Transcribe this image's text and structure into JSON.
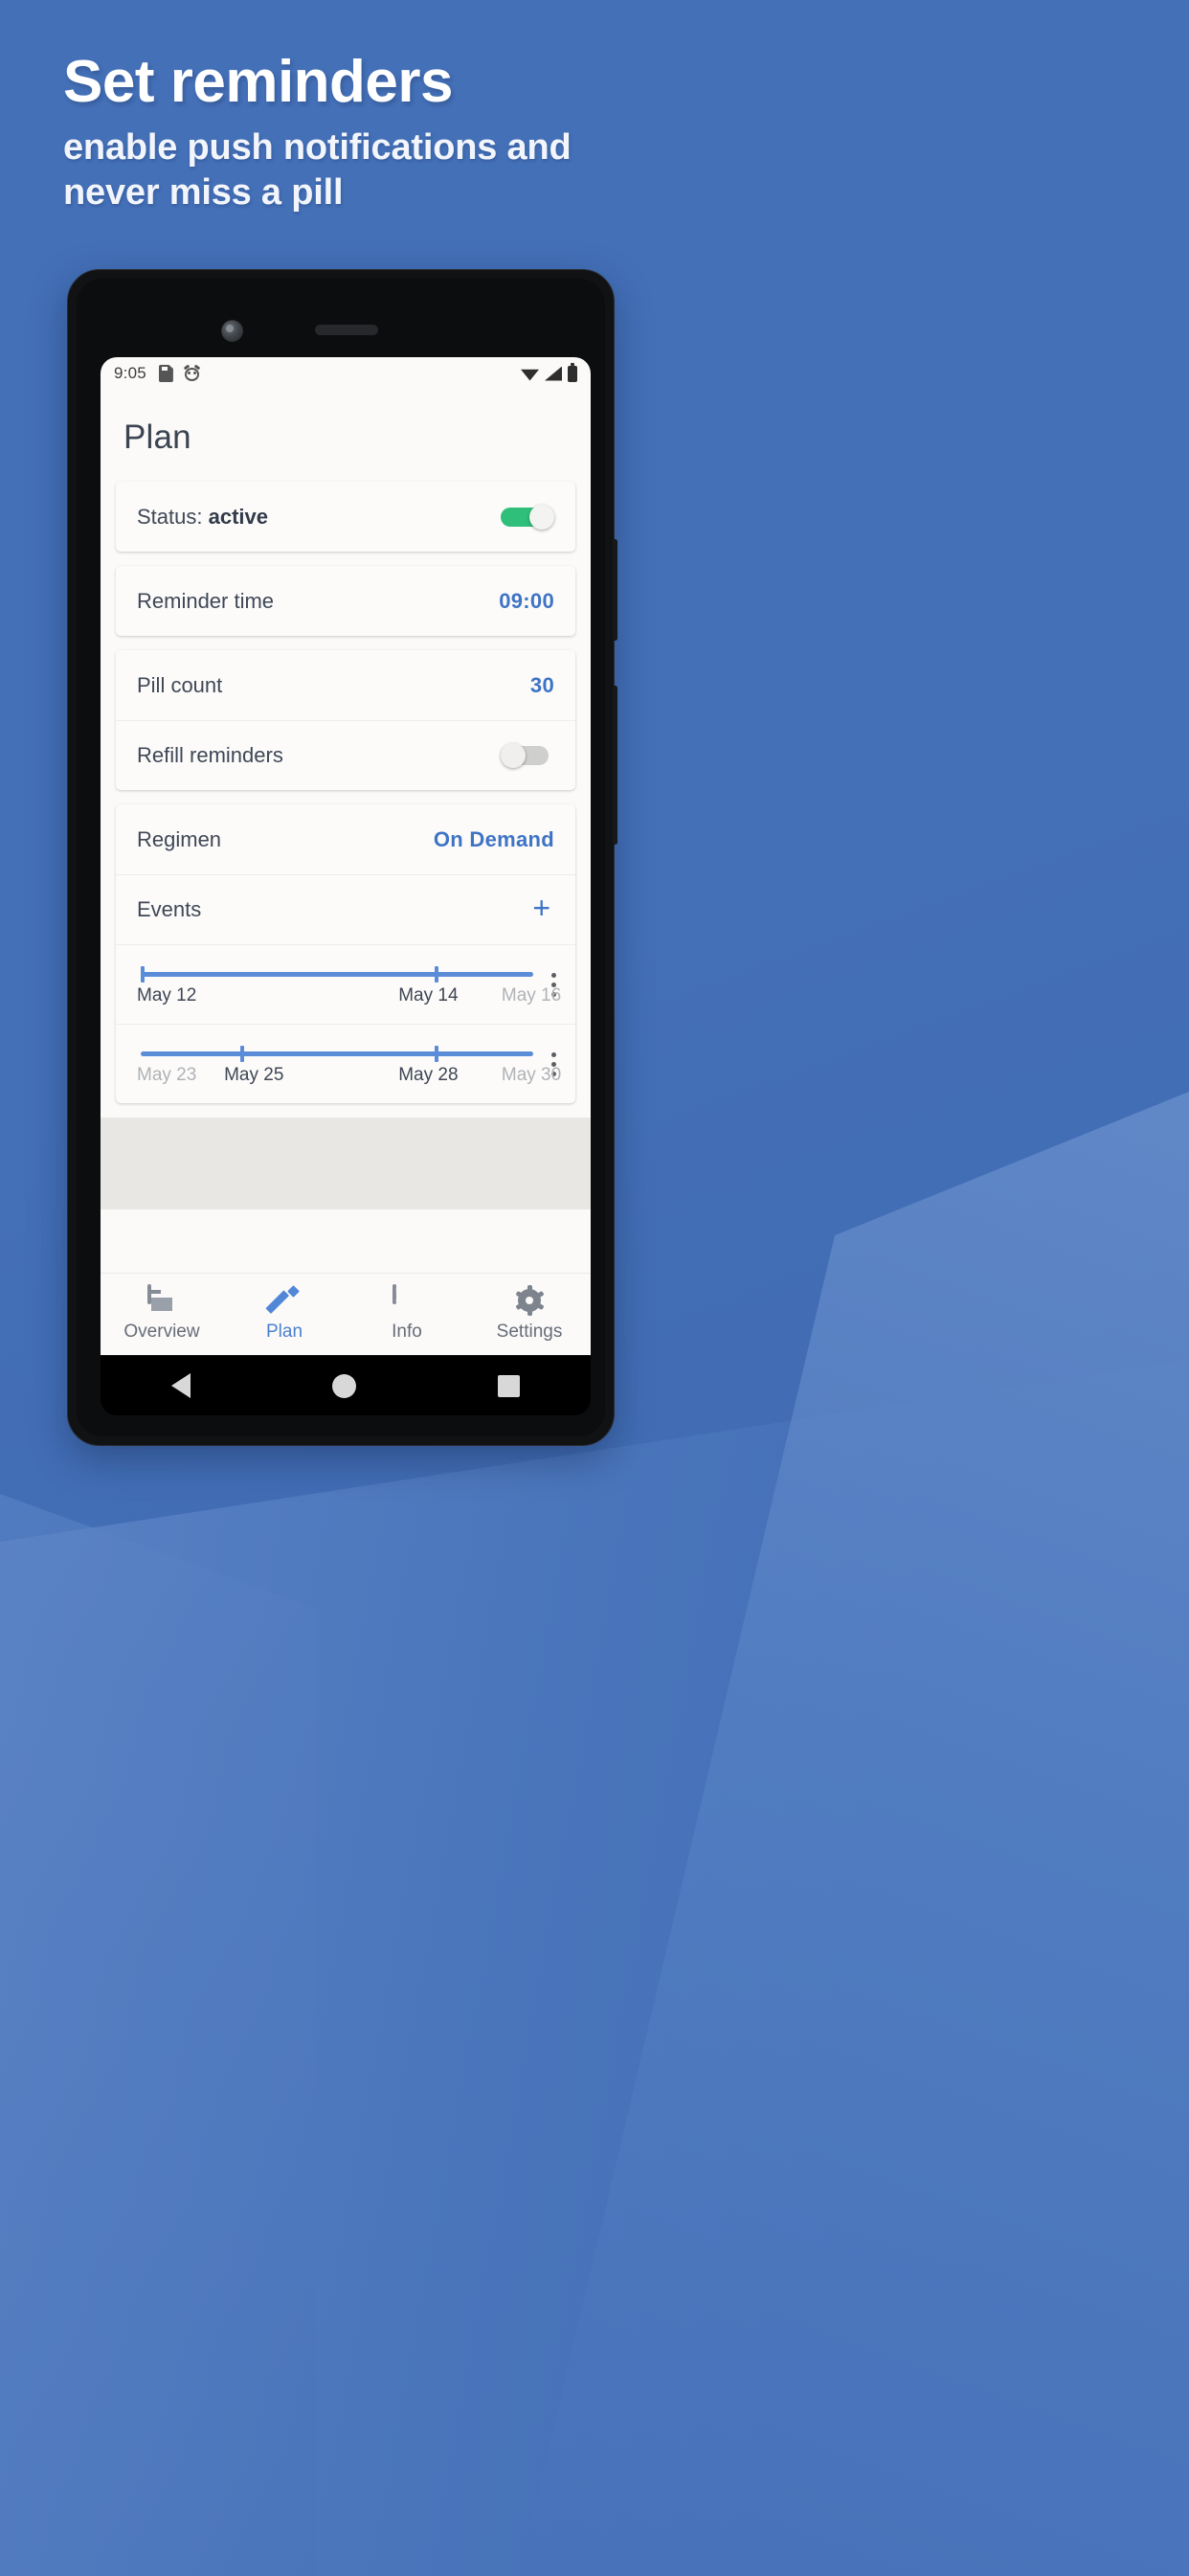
{
  "promo": {
    "headline": "Set reminders",
    "subhead": "enable push notifications and never miss a pill"
  },
  "colors": {
    "background_blue": "#4470b8",
    "accent_blue": "#3f74c4",
    "timeline_blue": "#5b8cd8",
    "toggle_on_green": "#2fbf7a",
    "toggle_off_gray": "#cfcfcd",
    "nav_active": "#4a80d0",
    "nav_inactive": "#666c77"
  },
  "statusbar": {
    "time": "9:05",
    "left_icons": [
      "sd-card-icon",
      "alarm-icon"
    ],
    "right_icons": [
      "wifi-icon",
      "signal-icon",
      "battery-icon"
    ]
  },
  "screen": {
    "page_title": "Plan",
    "cards": [
      {
        "rows": [
          {
            "label_prefix": "Status: ",
            "label_strong": "active",
            "control": "toggle",
            "toggle_state": "on"
          }
        ]
      },
      {
        "rows": [
          {
            "label": "Reminder time",
            "value": "09:00"
          }
        ]
      },
      {
        "rows": [
          {
            "label": "Pill count",
            "value": "30"
          },
          {
            "label": "Refill reminders",
            "control": "toggle",
            "toggle_state": "off"
          }
        ]
      },
      {
        "rows": [
          {
            "label": "Regimen",
            "value": "On Demand"
          },
          {
            "label": "Events",
            "control": "plus",
            "plus_label": "+"
          }
        ]
      }
    ],
    "events": [
      {
        "labels": [
          {
            "text": "May 12",
            "emphasis": "strong",
            "pos_pct": 0
          },
          {
            "text": "May 14",
            "emphasis": "strong",
            "pos_pct": 66
          },
          {
            "text": "May 16",
            "emphasis": "dim",
            "pos_pct": 92
          }
        ],
        "bar_start_pct": 1,
        "bar_end_pct": 100,
        "ticks_pct": [
          1,
          75
        ],
        "menu": "overflow-menu-icon"
      },
      {
        "labels": [
          {
            "text": "May 23",
            "emphasis": "dim",
            "pos_pct": 0
          },
          {
            "text": "May 25",
            "emphasis": "strong",
            "pos_pct": 22
          },
          {
            "text": "May 28",
            "emphasis": "strong",
            "pos_pct": 66
          },
          {
            "text": "May 30",
            "emphasis": "dim",
            "pos_pct": 92
          }
        ],
        "bar_start_pct": 1,
        "bar_end_pct": 100,
        "ticks_pct": [
          26,
          75
        ],
        "menu": "overflow-menu-icon"
      }
    ]
  },
  "bottom_nav": [
    {
      "label": "Overview",
      "icon": "article-icon",
      "active": false
    },
    {
      "label": "Plan",
      "icon": "pencil-icon",
      "active": true
    },
    {
      "label": "Info",
      "icon": "announcement-icon",
      "active": false
    },
    {
      "label": "Settings",
      "icon": "gear-icon",
      "active": false
    }
  ],
  "system_nav": {
    "back": "back-triangle-icon",
    "home": "home-circle-icon",
    "recents": "recents-square-icon"
  }
}
